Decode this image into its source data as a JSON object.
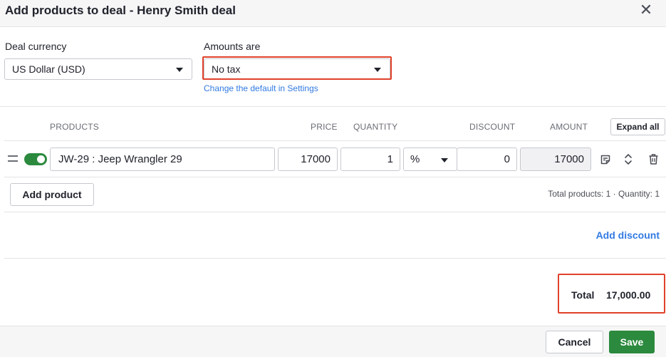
{
  "dialog": {
    "title": "Add products to deal - Henry Smith deal"
  },
  "settings": {
    "currency_label": "Deal currency",
    "currency_value": "US Dollar (USD)",
    "amounts_label": "Amounts are",
    "amounts_value": "No tax",
    "settings_link": "Change the default in Settings"
  },
  "table": {
    "headers": {
      "products": "PRODUCTS",
      "price": "PRICE",
      "quantity": "QUANTITY",
      "discount": "DISCOUNT",
      "amount": "AMOUNT"
    },
    "expand_all": "Expand all",
    "rows": [
      {
        "enabled": true,
        "product": "JW-29 : Jeep Wrangler 29",
        "price": "17000",
        "quantity": "1",
        "discount_type": "%",
        "discount": "0",
        "amount": "17000"
      }
    ]
  },
  "summary": {
    "add_product": "Add product",
    "totals_line": "Total products: 1 · Quantity: 1",
    "add_discount": "Add discount",
    "total_label": "Total",
    "total_value": "17,000.00"
  },
  "footer": {
    "cancel": "Cancel",
    "save": "Save"
  },
  "colors": {
    "accent_green": "#2b8a3e",
    "link_blue": "#317ae2",
    "highlight_red": "#e0412a"
  }
}
